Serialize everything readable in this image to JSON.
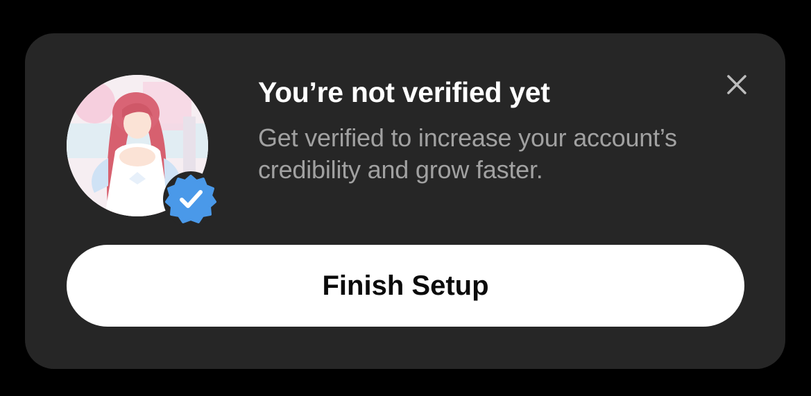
{
  "prompt": {
    "title": "You’re not verified yet",
    "description": "Get verified to increase your account’s credibility and grow faster.",
    "cta_label": "Finish Setup",
    "close_icon": "close-icon",
    "badge_icon": "verified-badge-icon"
  },
  "colors": {
    "background": "#000000",
    "card": "#262626",
    "title": "#ffffff",
    "description": "#a1a1a1",
    "button_bg": "#ffffff",
    "button_text": "#0b0b0b",
    "badge_blue": "#4a99e9"
  }
}
